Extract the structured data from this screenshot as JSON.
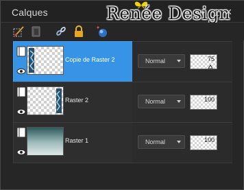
{
  "panel": {
    "title": "Calques"
  },
  "watermark": {
    "text": "Renée Design"
  },
  "layers": [
    {
      "name": "Copie de Raster 2",
      "blend_mode": "Normal",
      "opacity": "75",
      "opacity_value": 75,
      "selected": true
    },
    {
      "name": "Raster 2",
      "blend_mode": "Normal",
      "opacity": "100",
      "opacity_value": 100,
      "selected": false
    },
    {
      "name": "Raster 1",
      "blend_mode": "Normal",
      "opacity": "100",
      "opacity_value": 100,
      "selected": false
    }
  ],
  "colors": {
    "selection": "#3793e6",
    "panel_bg": "#262626",
    "accent_lock": "#e0a020"
  }
}
